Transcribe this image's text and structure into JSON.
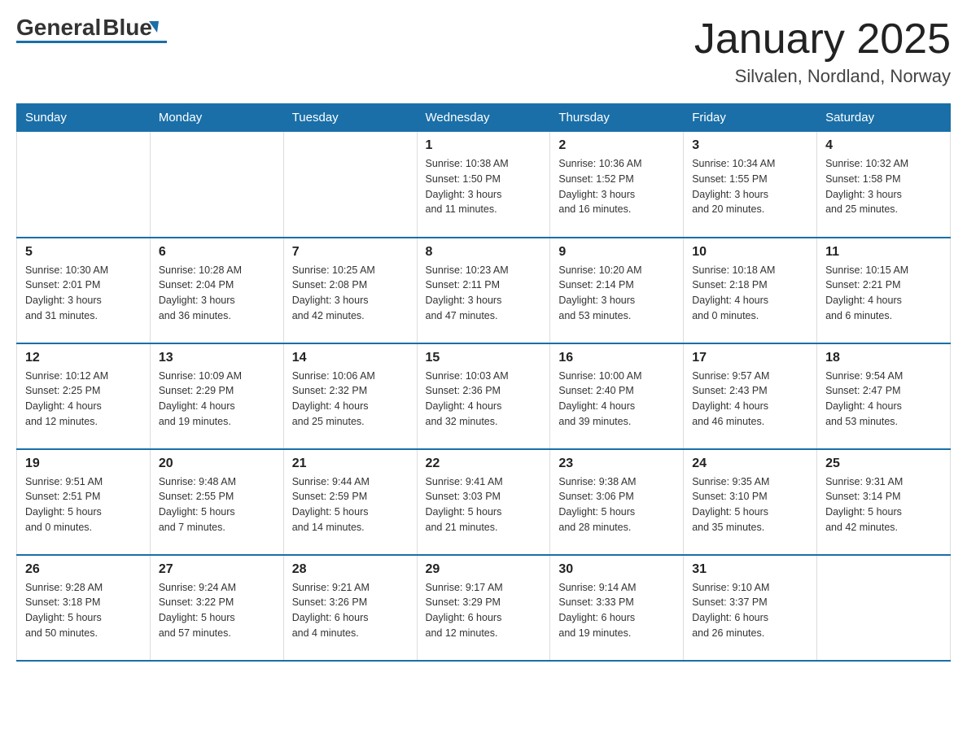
{
  "header": {
    "logo_general": "General",
    "logo_blue": "Blue",
    "month_title": "January 2025",
    "location": "Silvalen, Nordland, Norway"
  },
  "days_of_week": [
    "Sunday",
    "Monday",
    "Tuesday",
    "Wednesday",
    "Thursday",
    "Friday",
    "Saturday"
  ],
  "weeks": [
    [
      {
        "num": "",
        "info": ""
      },
      {
        "num": "",
        "info": ""
      },
      {
        "num": "",
        "info": ""
      },
      {
        "num": "1",
        "info": "Sunrise: 10:38 AM\nSunset: 1:50 PM\nDaylight: 3 hours\nand 11 minutes."
      },
      {
        "num": "2",
        "info": "Sunrise: 10:36 AM\nSunset: 1:52 PM\nDaylight: 3 hours\nand 16 minutes."
      },
      {
        "num": "3",
        "info": "Sunrise: 10:34 AM\nSunset: 1:55 PM\nDaylight: 3 hours\nand 20 minutes."
      },
      {
        "num": "4",
        "info": "Sunrise: 10:32 AM\nSunset: 1:58 PM\nDaylight: 3 hours\nand 25 minutes."
      }
    ],
    [
      {
        "num": "5",
        "info": "Sunrise: 10:30 AM\nSunset: 2:01 PM\nDaylight: 3 hours\nand 31 minutes."
      },
      {
        "num": "6",
        "info": "Sunrise: 10:28 AM\nSunset: 2:04 PM\nDaylight: 3 hours\nand 36 minutes."
      },
      {
        "num": "7",
        "info": "Sunrise: 10:25 AM\nSunset: 2:08 PM\nDaylight: 3 hours\nand 42 minutes."
      },
      {
        "num": "8",
        "info": "Sunrise: 10:23 AM\nSunset: 2:11 PM\nDaylight: 3 hours\nand 47 minutes."
      },
      {
        "num": "9",
        "info": "Sunrise: 10:20 AM\nSunset: 2:14 PM\nDaylight: 3 hours\nand 53 minutes."
      },
      {
        "num": "10",
        "info": "Sunrise: 10:18 AM\nSunset: 2:18 PM\nDaylight: 4 hours\nand 0 minutes."
      },
      {
        "num": "11",
        "info": "Sunrise: 10:15 AM\nSunset: 2:21 PM\nDaylight: 4 hours\nand 6 minutes."
      }
    ],
    [
      {
        "num": "12",
        "info": "Sunrise: 10:12 AM\nSunset: 2:25 PM\nDaylight: 4 hours\nand 12 minutes."
      },
      {
        "num": "13",
        "info": "Sunrise: 10:09 AM\nSunset: 2:29 PM\nDaylight: 4 hours\nand 19 minutes."
      },
      {
        "num": "14",
        "info": "Sunrise: 10:06 AM\nSunset: 2:32 PM\nDaylight: 4 hours\nand 25 minutes."
      },
      {
        "num": "15",
        "info": "Sunrise: 10:03 AM\nSunset: 2:36 PM\nDaylight: 4 hours\nand 32 minutes."
      },
      {
        "num": "16",
        "info": "Sunrise: 10:00 AM\nSunset: 2:40 PM\nDaylight: 4 hours\nand 39 minutes."
      },
      {
        "num": "17",
        "info": "Sunrise: 9:57 AM\nSunset: 2:43 PM\nDaylight: 4 hours\nand 46 minutes."
      },
      {
        "num": "18",
        "info": "Sunrise: 9:54 AM\nSunset: 2:47 PM\nDaylight: 4 hours\nand 53 minutes."
      }
    ],
    [
      {
        "num": "19",
        "info": "Sunrise: 9:51 AM\nSunset: 2:51 PM\nDaylight: 5 hours\nand 0 minutes."
      },
      {
        "num": "20",
        "info": "Sunrise: 9:48 AM\nSunset: 2:55 PM\nDaylight: 5 hours\nand 7 minutes."
      },
      {
        "num": "21",
        "info": "Sunrise: 9:44 AM\nSunset: 2:59 PM\nDaylight: 5 hours\nand 14 minutes."
      },
      {
        "num": "22",
        "info": "Sunrise: 9:41 AM\nSunset: 3:03 PM\nDaylight: 5 hours\nand 21 minutes."
      },
      {
        "num": "23",
        "info": "Sunrise: 9:38 AM\nSunset: 3:06 PM\nDaylight: 5 hours\nand 28 minutes."
      },
      {
        "num": "24",
        "info": "Sunrise: 9:35 AM\nSunset: 3:10 PM\nDaylight: 5 hours\nand 35 minutes."
      },
      {
        "num": "25",
        "info": "Sunrise: 9:31 AM\nSunset: 3:14 PM\nDaylight: 5 hours\nand 42 minutes."
      }
    ],
    [
      {
        "num": "26",
        "info": "Sunrise: 9:28 AM\nSunset: 3:18 PM\nDaylight: 5 hours\nand 50 minutes."
      },
      {
        "num": "27",
        "info": "Sunrise: 9:24 AM\nSunset: 3:22 PM\nDaylight: 5 hours\nand 57 minutes."
      },
      {
        "num": "28",
        "info": "Sunrise: 9:21 AM\nSunset: 3:26 PM\nDaylight: 6 hours\nand 4 minutes."
      },
      {
        "num": "29",
        "info": "Sunrise: 9:17 AM\nSunset: 3:29 PM\nDaylight: 6 hours\nand 12 minutes."
      },
      {
        "num": "30",
        "info": "Sunrise: 9:14 AM\nSunset: 3:33 PM\nDaylight: 6 hours\nand 19 minutes."
      },
      {
        "num": "31",
        "info": "Sunrise: 9:10 AM\nSunset: 3:37 PM\nDaylight: 6 hours\nand 26 minutes."
      },
      {
        "num": "",
        "info": ""
      }
    ]
  ]
}
